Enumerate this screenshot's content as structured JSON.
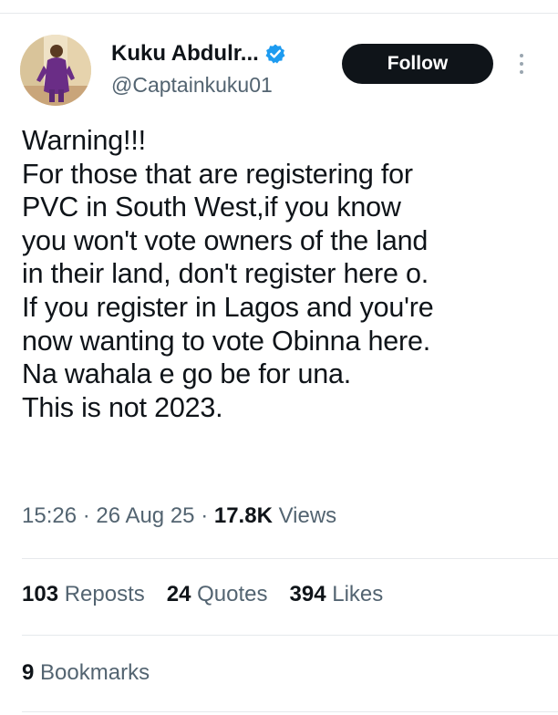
{
  "user": {
    "display_name": "Kuku Abdulr...",
    "handle": "@Captainkuku01",
    "verified_icon": "verified-badge-icon",
    "accent_color": "#1d9bf0"
  },
  "actions": {
    "follow_label": "Follow",
    "more_icon": "more-vertical-icon"
  },
  "tweet": {
    "lines": [
      "Warning!!!",
      "For those that are registering for",
      "PVC in South West,if you know",
      "you won't vote owners of the land",
      "in their land, don't register  here o.",
      "If you register in Lagos and you're",
      "now wanting to vote Obinna here.",
      "Na wahala e go be for una.",
      "This is not 2023."
    ]
  },
  "meta": {
    "time": "15:26",
    "date": "26 Aug 25",
    "views_count": "17.8K",
    "views_label": "Views"
  },
  "stats": {
    "reposts_count": "103",
    "reposts_label": "Reposts",
    "quotes_count": "24",
    "quotes_label": "Quotes",
    "likes_count": "394",
    "likes_label": "Likes",
    "bookmarks_count": "9",
    "bookmarks_label": "Bookmarks"
  }
}
